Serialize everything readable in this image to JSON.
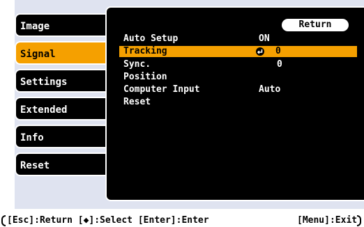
{
  "sidebar": {
    "items": [
      {
        "label": "Image"
      },
      {
        "label": "Signal"
      },
      {
        "label": "Settings"
      },
      {
        "label": "Extended"
      },
      {
        "label": "Info"
      },
      {
        "label": "Reset"
      }
    ],
    "selected": "Signal"
  },
  "submenu": {
    "return_label": "Return",
    "rows": [
      {
        "label": "Auto Setup",
        "value": "ON"
      },
      {
        "label": "Tracking",
        "value": "0"
      },
      {
        "label": "Sync.",
        "value": "0"
      },
      {
        "label": "Position",
        "value": ""
      },
      {
        "label": "Computer Input",
        "value": "Auto"
      },
      {
        "label": "Reset",
        "value": ""
      }
    ],
    "selected": "Tracking"
  },
  "statusbar": {
    "left_text": "[Esc]:Return [◆]:Select [Enter]:Enter",
    "right_text": "[Menu]:Exit"
  },
  "colors": {
    "accent": "#f5a000",
    "panel": "#000000",
    "background": "#dfe3f0"
  }
}
